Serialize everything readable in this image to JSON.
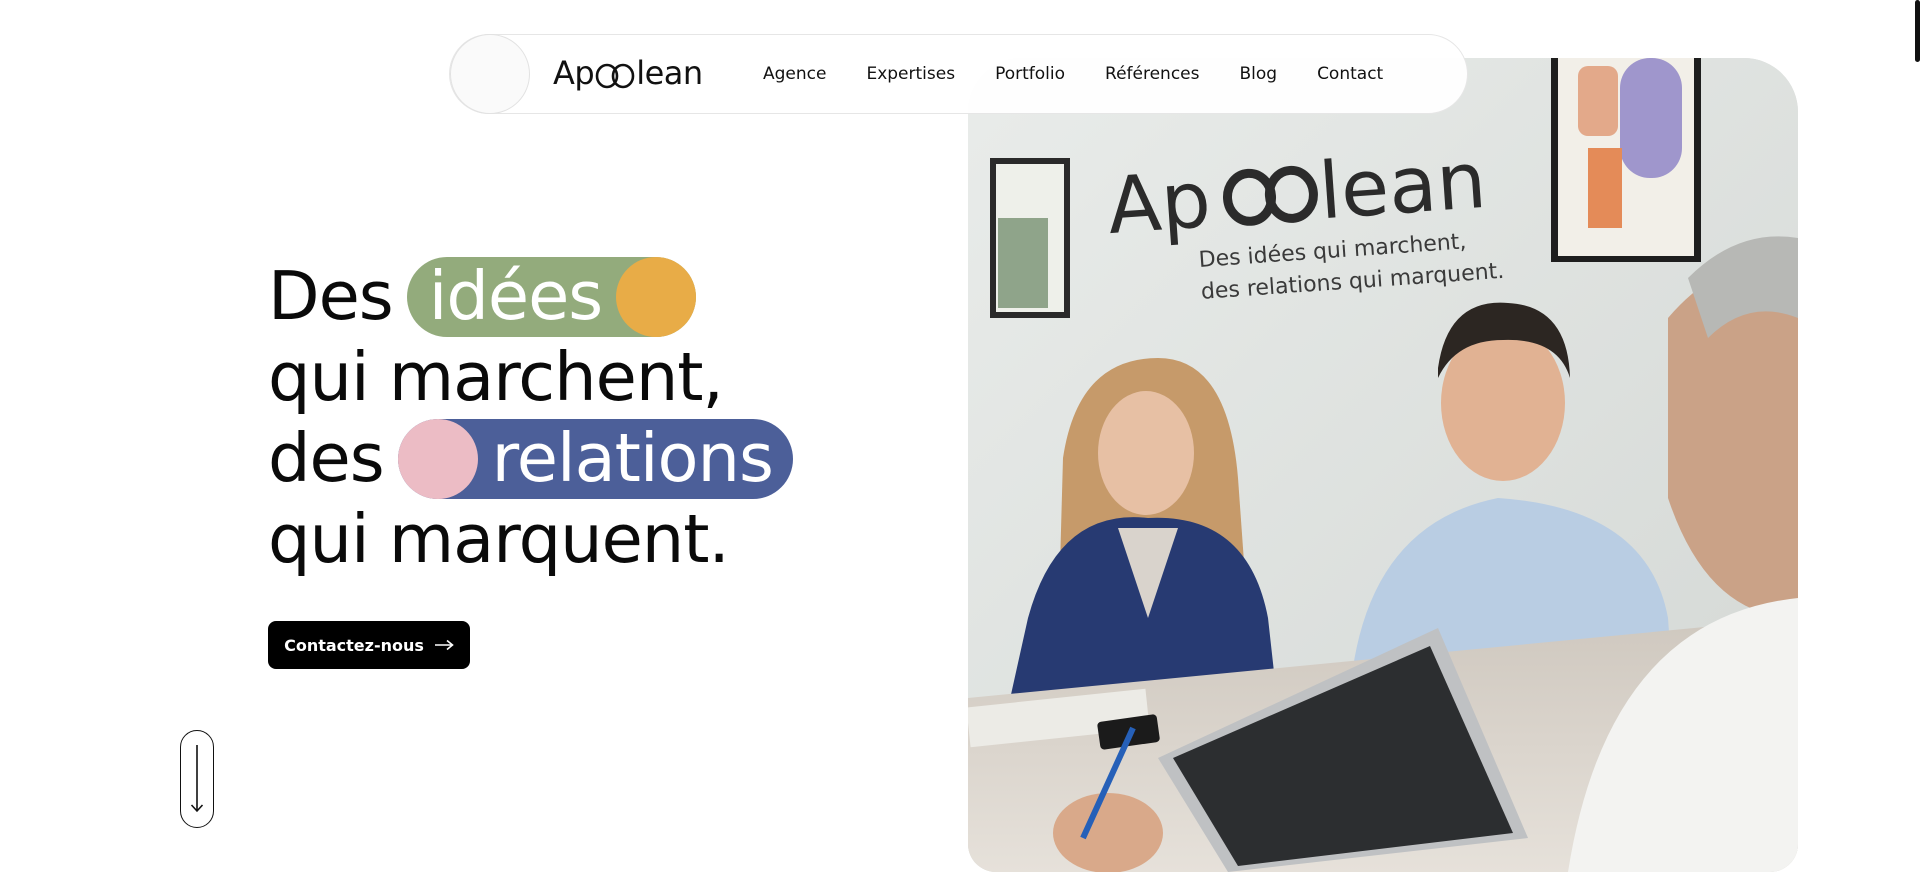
{
  "brand": {
    "name_left": "Ap",
    "name_right": "lean"
  },
  "nav": {
    "items": [
      {
        "label": "Agence"
      },
      {
        "label": "Expertises"
      },
      {
        "label": "Portfolio"
      },
      {
        "label": "Références"
      },
      {
        "label": "Blog"
      },
      {
        "label": "Contact"
      }
    ]
  },
  "hero": {
    "line1_word": "Des",
    "line1_pill": "idées",
    "line2": "qui marchent,",
    "line3_word": "des",
    "line3_pill": "relations",
    "line4": "qui marquent.",
    "cta_label": "Contactez-nous"
  },
  "photo": {
    "wall_brand_left": "Ap",
    "wall_brand_right": "lean",
    "wall_tagline_1": "Des idées qui marchent,",
    "wall_tagline_2": "des relations qui marquent."
  },
  "colors": {
    "pill_green": "#93ab7c",
    "dot_orange": "#e8ac47",
    "pill_blue": "#4c5f99",
    "dot_pink": "#ecbcc5",
    "cta_bg": "#000000"
  },
  "icons": [
    "logo-loop-icon",
    "arrow-right-icon",
    "arrow-down-icon"
  ]
}
